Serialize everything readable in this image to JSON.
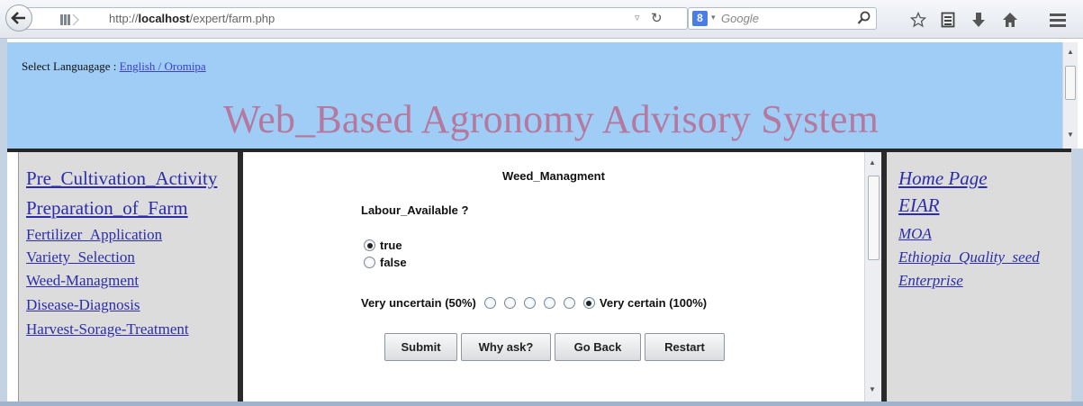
{
  "browser": {
    "url_prefix": "http://",
    "url_host": "localhost",
    "url_path": "/expert/farm.php",
    "search_engine_letter": "8",
    "search_placeholder": "Google",
    "icons": [
      "back-arrow-icon",
      "page-grip-icon",
      "reload-icon",
      "search-icon",
      "star-icon",
      "bookmarks-list-icon",
      "download-icon",
      "home-icon",
      "menu-icon"
    ]
  },
  "header": {
    "language_label": "Select Languagage : ",
    "language_link": "English / Oromipa",
    "title": "Web_Based Agronomy Advisory System",
    "background": "#9fcdf6",
    "title_color": "#b5799f"
  },
  "left_nav": {
    "items": [
      {
        "label": "Pre_Cultivation_Activity"
      },
      {
        "label": "Preparation_of_Farm"
      },
      {
        "label": "Fertilizer_Application"
      },
      {
        "label": "Variety_Selection"
      },
      {
        "label": "Weed-Managment"
      },
      {
        "label": "Disease-Diagnosis"
      },
      {
        "label": "Harvest-Sorage-Treatment"
      }
    ]
  },
  "main": {
    "section_title": "Weed_Managment",
    "question": "Labour_Available ?",
    "options": [
      {
        "label": "true",
        "selected": true
      },
      {
        "label": "false",
        "selected": false
      }
    ],
    "certainty_low_label": "Very uncertain (50%)",
    "certainty_high_label": "Very certain (100%)",
    "certainty_selected": "Very certain (100%)",
    "buttons": {
      "submit": "Submit",
      "why": "Why ask?",
      "back": "Go Back",
      "restart": "Restart"
    }
  },
  "right_nav": {
    "items": [
      {
        "label": "Home Page"
      },
      {
        "label": "EIAR"
      },
      {
        "label": "MOA"
      },
      {
        "label": "Ethiopia_Quality_seed"
      },
      {
        "label": "Enterprise"
      }
    ]
  }
}
